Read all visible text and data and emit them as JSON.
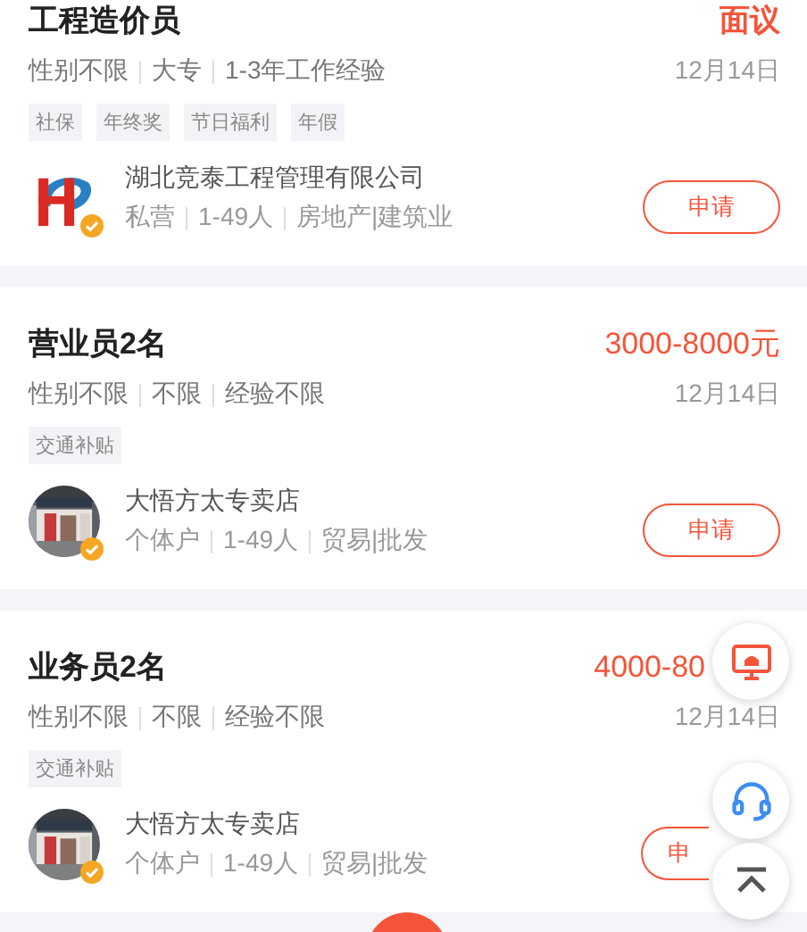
{
  "jobs": [
    {
      "title": "工程造价员",
      "salary": "面议",
      "meta": [
        "性别不限",
        "大专",
        "1-3年工作经验"
      ],
      "date": "12月14日",
      "tags": [
        "社保",
        "年终奖",
        "节日福利",
        "年假"
      ],
      "company": {
        "name": "湖北竞泰工程管理有限公司",
        "kind": "logo",
        "verified": true,
        "info": [
          "私营",
          "1-49人",
          "房地产|建筑业"
        ]
      },
      "apply": "申请"
    },
    {
      "title": "营业员2名",
      "salary": "3000-8000元",
      "meta": [
        "性别不限",
        "不限",
        "经验不限"
      ],
      "date": "12月14日",
      "tags": [
        "交通补贴"
      ],
      "company": {
        "name": "大悟方太专卖店",
        "kind": "picture",
        "verified": true,
        "info": [
          "个体户",
          "1-49人",
          "贸易|批发"
        ]
      },
      "apply": "申请"
    },
    {
      "title": "业务员2名",
      "salary": "4000-80",
      "meta": [
        "性别不限",
        "不限",
        "经验不限"
      ],
      "date": "12月14日",
      "tags": [
        "交通补贴"
      ],
      "company": {
        "name": "大悟方太专卖店",
        "kind": "picture",
        "verified": true,
        "info": [
          "个体户",
          "1-49人",
          "贸易|批发"
        ]
      },
      "apply": "申"
    }
  ]
}
